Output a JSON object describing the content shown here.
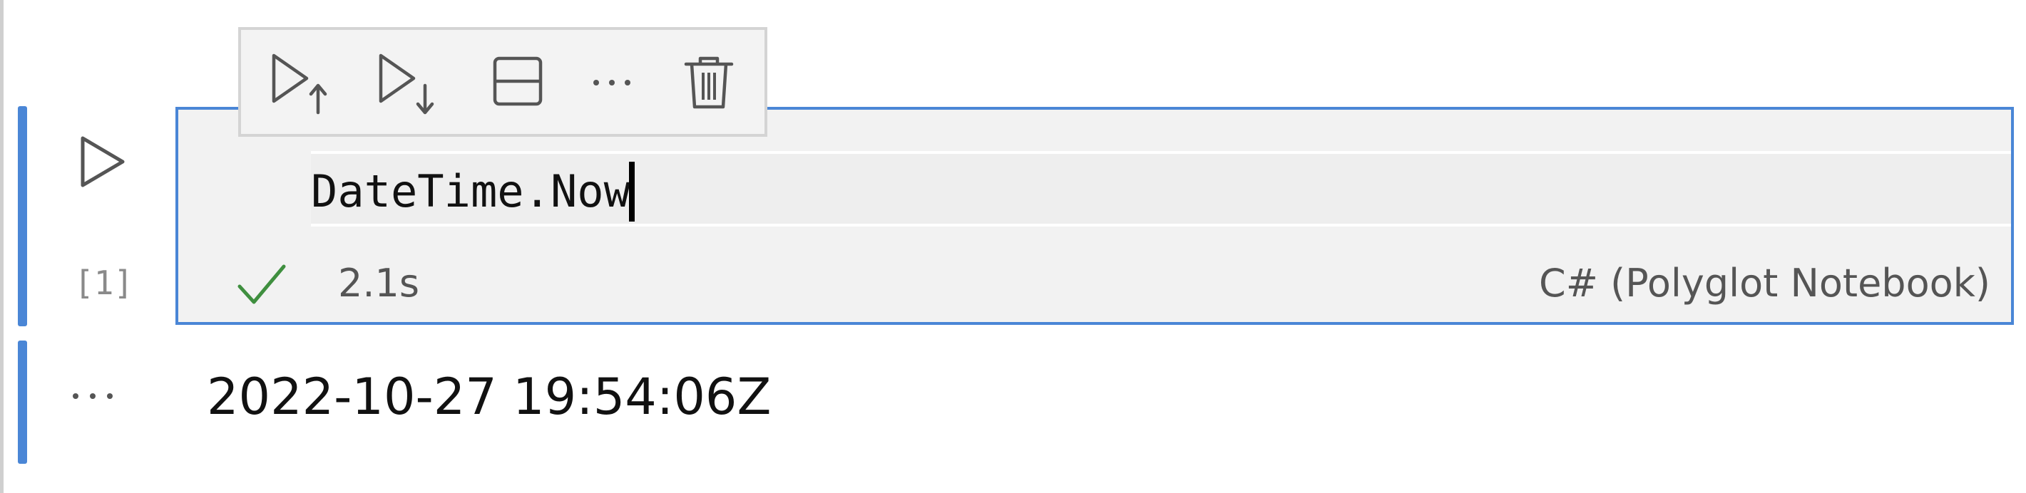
{
  "cell": {
    "code": "DateTime.Now",
    "execution_count": "[1]",
    "duration": "2.1s",
    "kernel": "C# (Polyglot Notebook)",
    "status_icon": "check-icon",
    "run_icon": "play-icon"
  },
  "toolbar": {
    "buttons": [
      {
        "name": "execute-above-button",
        "icon": "execute-above-icon"
      },
      {
        "name": "execute-below-button",
        "icon": "execute-below-icon"
      },
      {
        "name": "split-cell-button",
        "icon": "split-cell-icon"
      },
      {
        "name": "more-actions-button",
        "icon": "ellipsis-icon"
      },
      {
        "name": "delete-cell-button",
        "icon": "trash-icon"
      }
    ]
  },
  "output": {
    "text": "2022-10-27 19:54:06Z",
    "menu_icon": "ellipsis-icon"
  },
  "colors": {
    "focus": "#4a86d6",
    "success": "#3f8f3f",
    "cell_background": "#f2f2f2",
    "muted_text": "#555555"
  }
}
